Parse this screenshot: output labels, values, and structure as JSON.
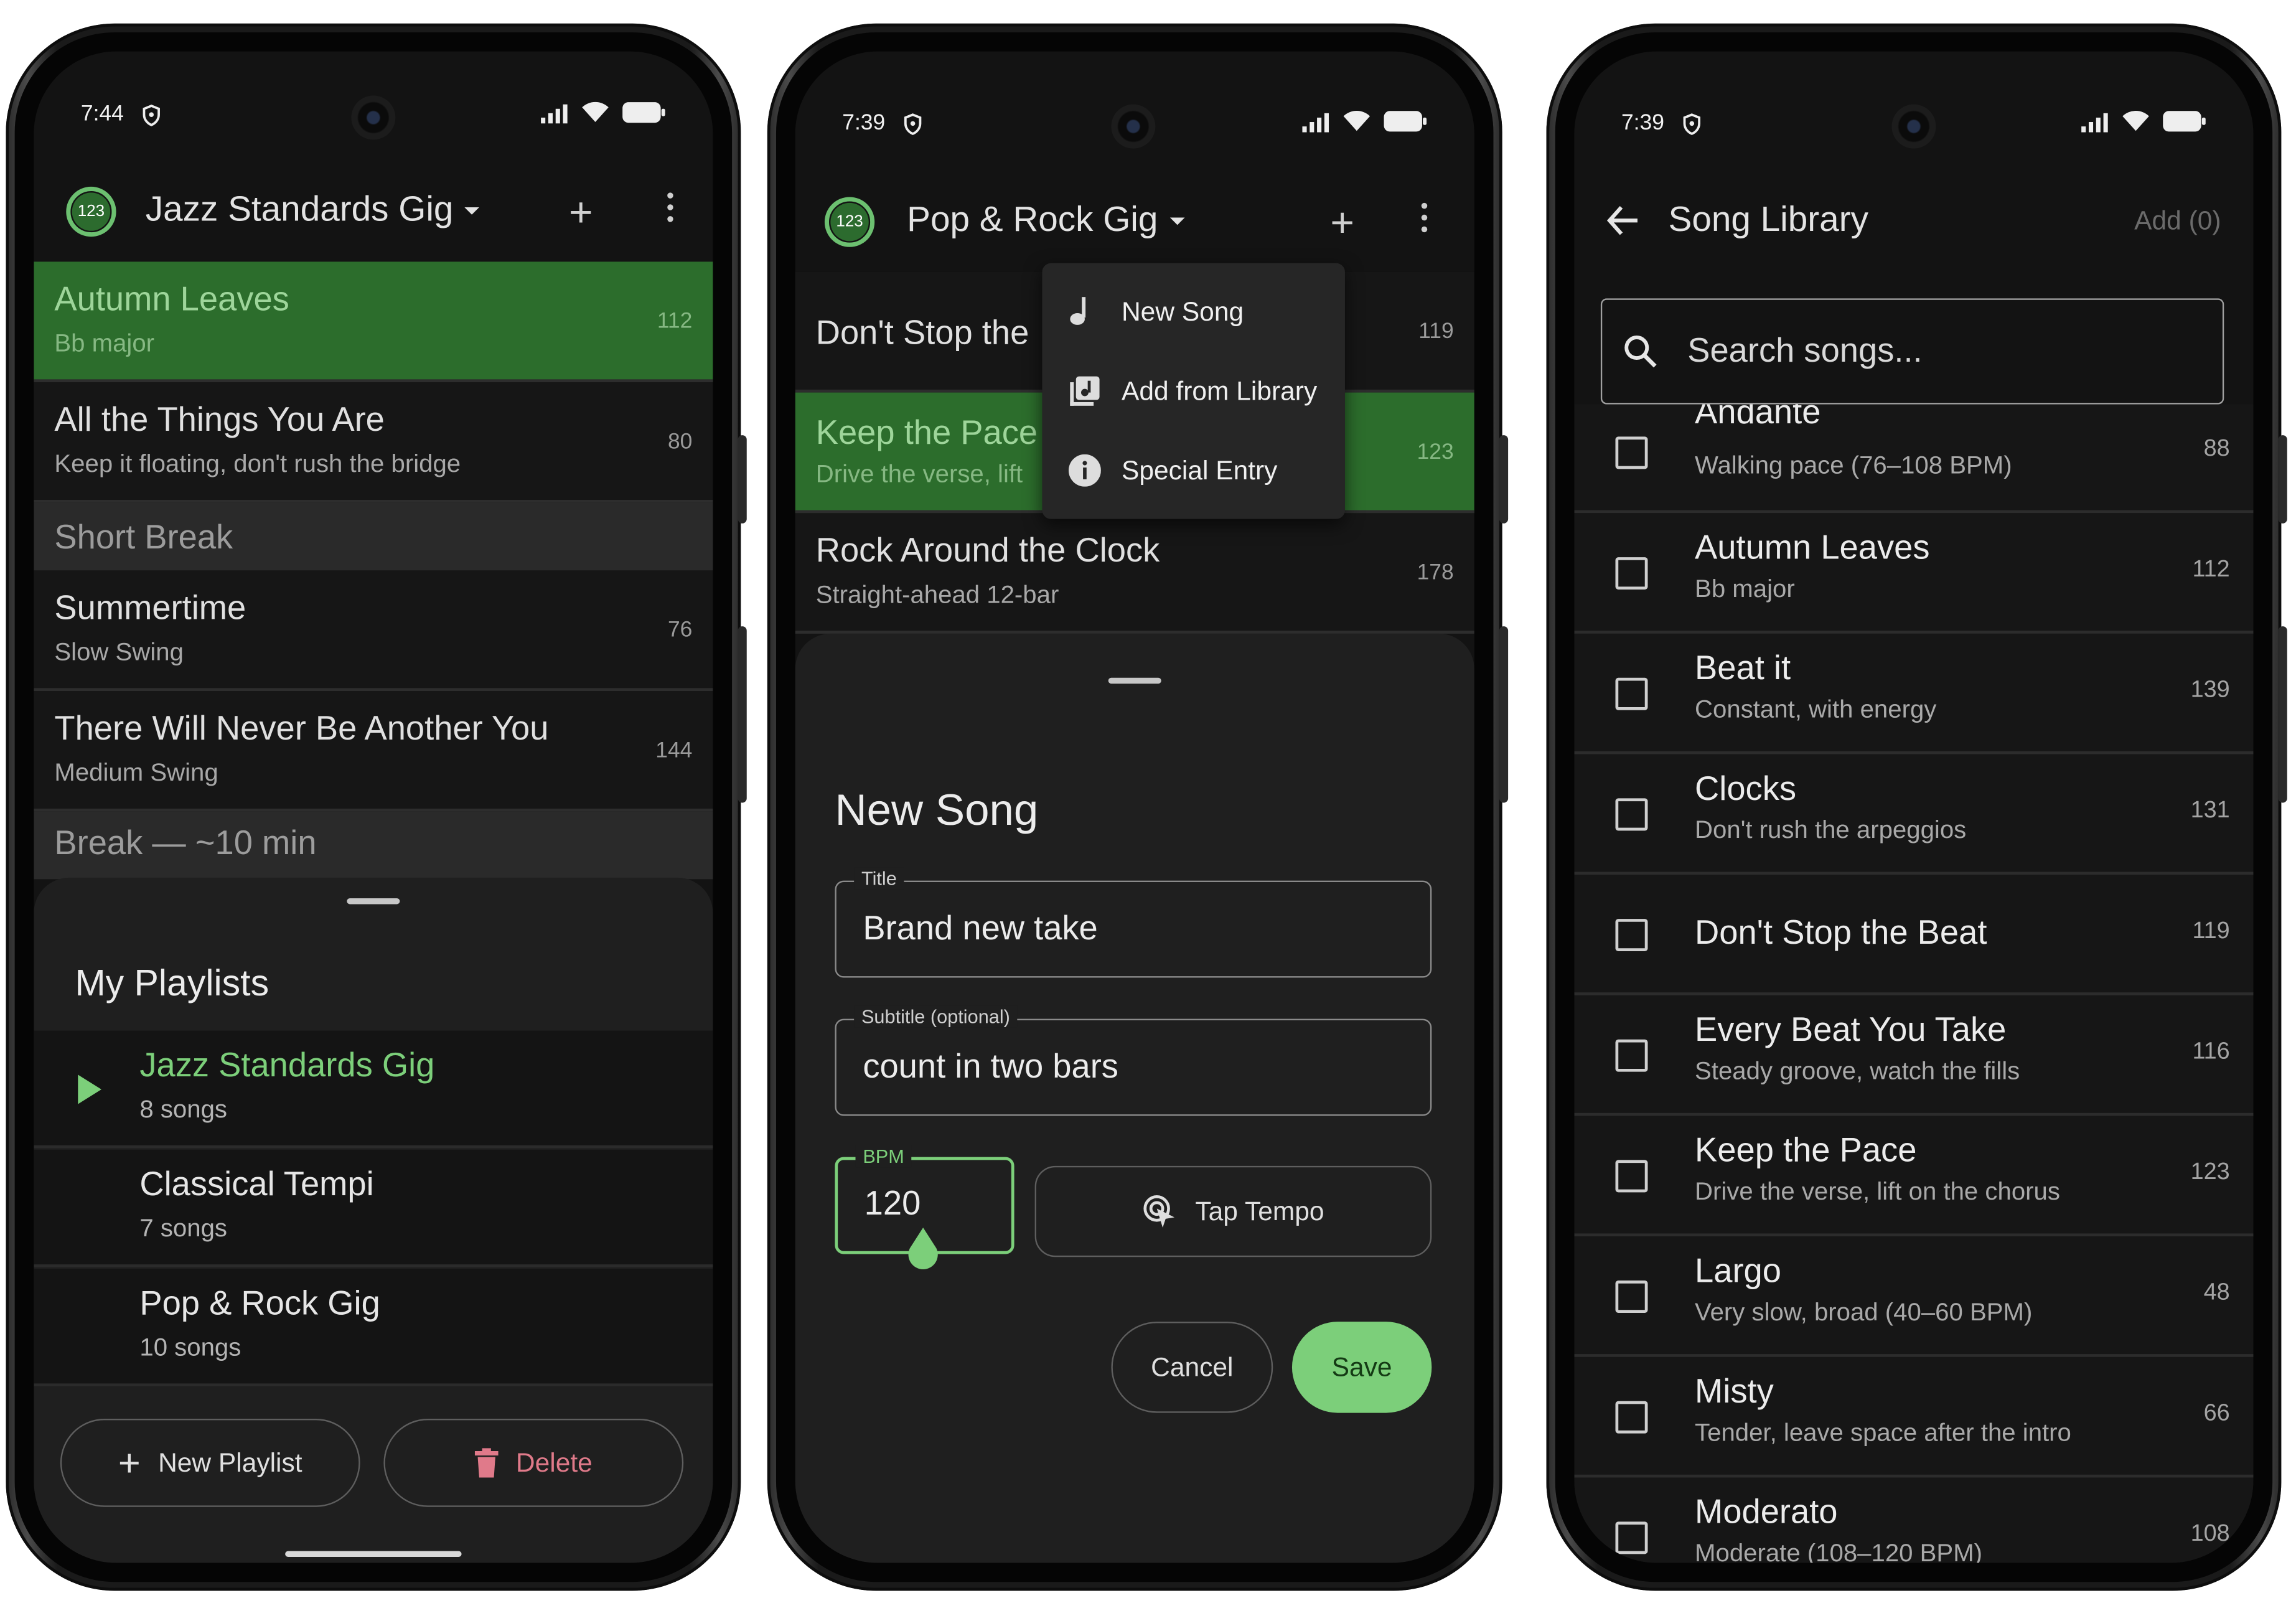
{
  "colors": {
    "accent": "#7ccf7a",
    "active_row": "#2c6d2c",
    "delete": "#e07a8a",
    "background": "#131313"
  },
  "phone1": {
    "status": {
      "time": "7:44"
    },
    "appbar": {
      "logo": "123",
      "title": "Jazz Standards Gig",
      "add_icon": "plus-icon",
      "menu_icon": "more-vert-icon"
    },
    "songs": [
      {
        "title": "Autumn Leaves",
        "subtitle": "Bb major",
        "bpm": "112"
      },
      {
        "title": "All the Things You Are",
        "subtitle": "Keep it floating, don't rush the bridge",
        "bpm": "80"
      },
      {
        "break": "Short Break"
      },
      {
        "title": "Summertime",
        "subtitle": "Slow Swing",
        "bpm": "76"
      },
      {
        "title": "There Will Never Be Another You",
        "subtitle": "Medium Swing",
        "bpm": "144"
      },
      {
        "break": "Break — ~10 min"
      }
    ],
    "sheet": {
      "title": "My Playlists",
      "playlists": [
        {
          "name": "Jazz Standards Gig",
          "count": "8 songs"
        },
        {
          "name": "Classical Tempi",
          "count": "7 songs"
        },
        {
          "name": "Pop & Rock Gig",
          "count": "10 songs"
        }
      ],
      "new_label": "New Playlist",
      "delete_label": "Delete"
    }
  },
  "phone2": {
    "status": {
      "time": "7:39"
    },
    "appbar": {
      "logo": "123",
      "title": "Pop & Rock Gig"
    },
    "songs": [
      {
        "title": "Don't Stop the",
        "bpm": "119"
      },
      {
        "title": "Keep the Pace",
        "subtitle": "Drive the verse, lift",
        "bpm": "123"
      },
      {
        "title": "Rock Around the Clock",
        "subtitle": "Straight-ahead 12-bar",
        "bpm": "178"
      }
    ],
    "menu": [
      {
        "label": "New Song",
        "icon": "music-note-icon"
      },
      {
        "label": "Add from Library",
        "icon": "library-music-icon"
      },
      {
        "label": "Special Entry",
        "icon": "info-icon"
      }
    ],
    "dialog": {
      "title": "New Song",
      "title_label": "Title",
      "title_value": "Brand new take",
      "subtitle_label": "Subtitle (optional)",
      "subtitle_value": "count in two bars",
      "bpm_label": "BPM",
      "bpm_value": "120",
      "tap_label": "Tap Tempo",
      "cancel_label": "Cancel",
      "save_label": "Save"
    }
  },
  "phone3": {
    "status": {
      "time": "7:39"
    },
    "appbar": {
      "title": "Song Library",
      "add_label": "Add (0)"
    },
    "search": {
      "placeholder": "Search songs..."
    },
    "songs": [
      {
        "title": "Andante",
        "subtitle": "Walking pace (76–108 BPM)",
        "bpm": "88"
      },
      {
        "title": "Autumn Leaves",
        "subtitle": "Bb major",
        "bpm": "112"
      },
      {
        "title": "Beat it",
        "subtitle": "Constant, with energy",
        "bpm": "139"
      },
      {
        "title": "Clocks",
        "subtitle": "Don't rush the arpeggios",
        "bpm": "131"
      },
      {
        "title": "Don't Stop the Beat",
        "subtitle": "",
        "bpm": "119"
      },
      {
        "title": "Every Beat You Take",
        "subtitle": "Steady groove, watch the fills",
        "bpm": "116"
      },
      {
        "title": "Keep the Pace",
        "subtitle": "Drive the verse, lift on the chorus",
        "bpm": "123"
      },
      {
        "title": "Largo",
        "subtitle": "Very slow, broad (40–60 BPM)",
        "bpm": "48"
      },
      {
        "title": "Misty",
        "subtitle": "Tender, leave space after the intro",
        "bpm": "66"
      },
      {
        "title": "Moderato",
        "subtitle": "Moderate (108–120 BPM)",
        "bpm": "108"
      }
    ]
  }
}
